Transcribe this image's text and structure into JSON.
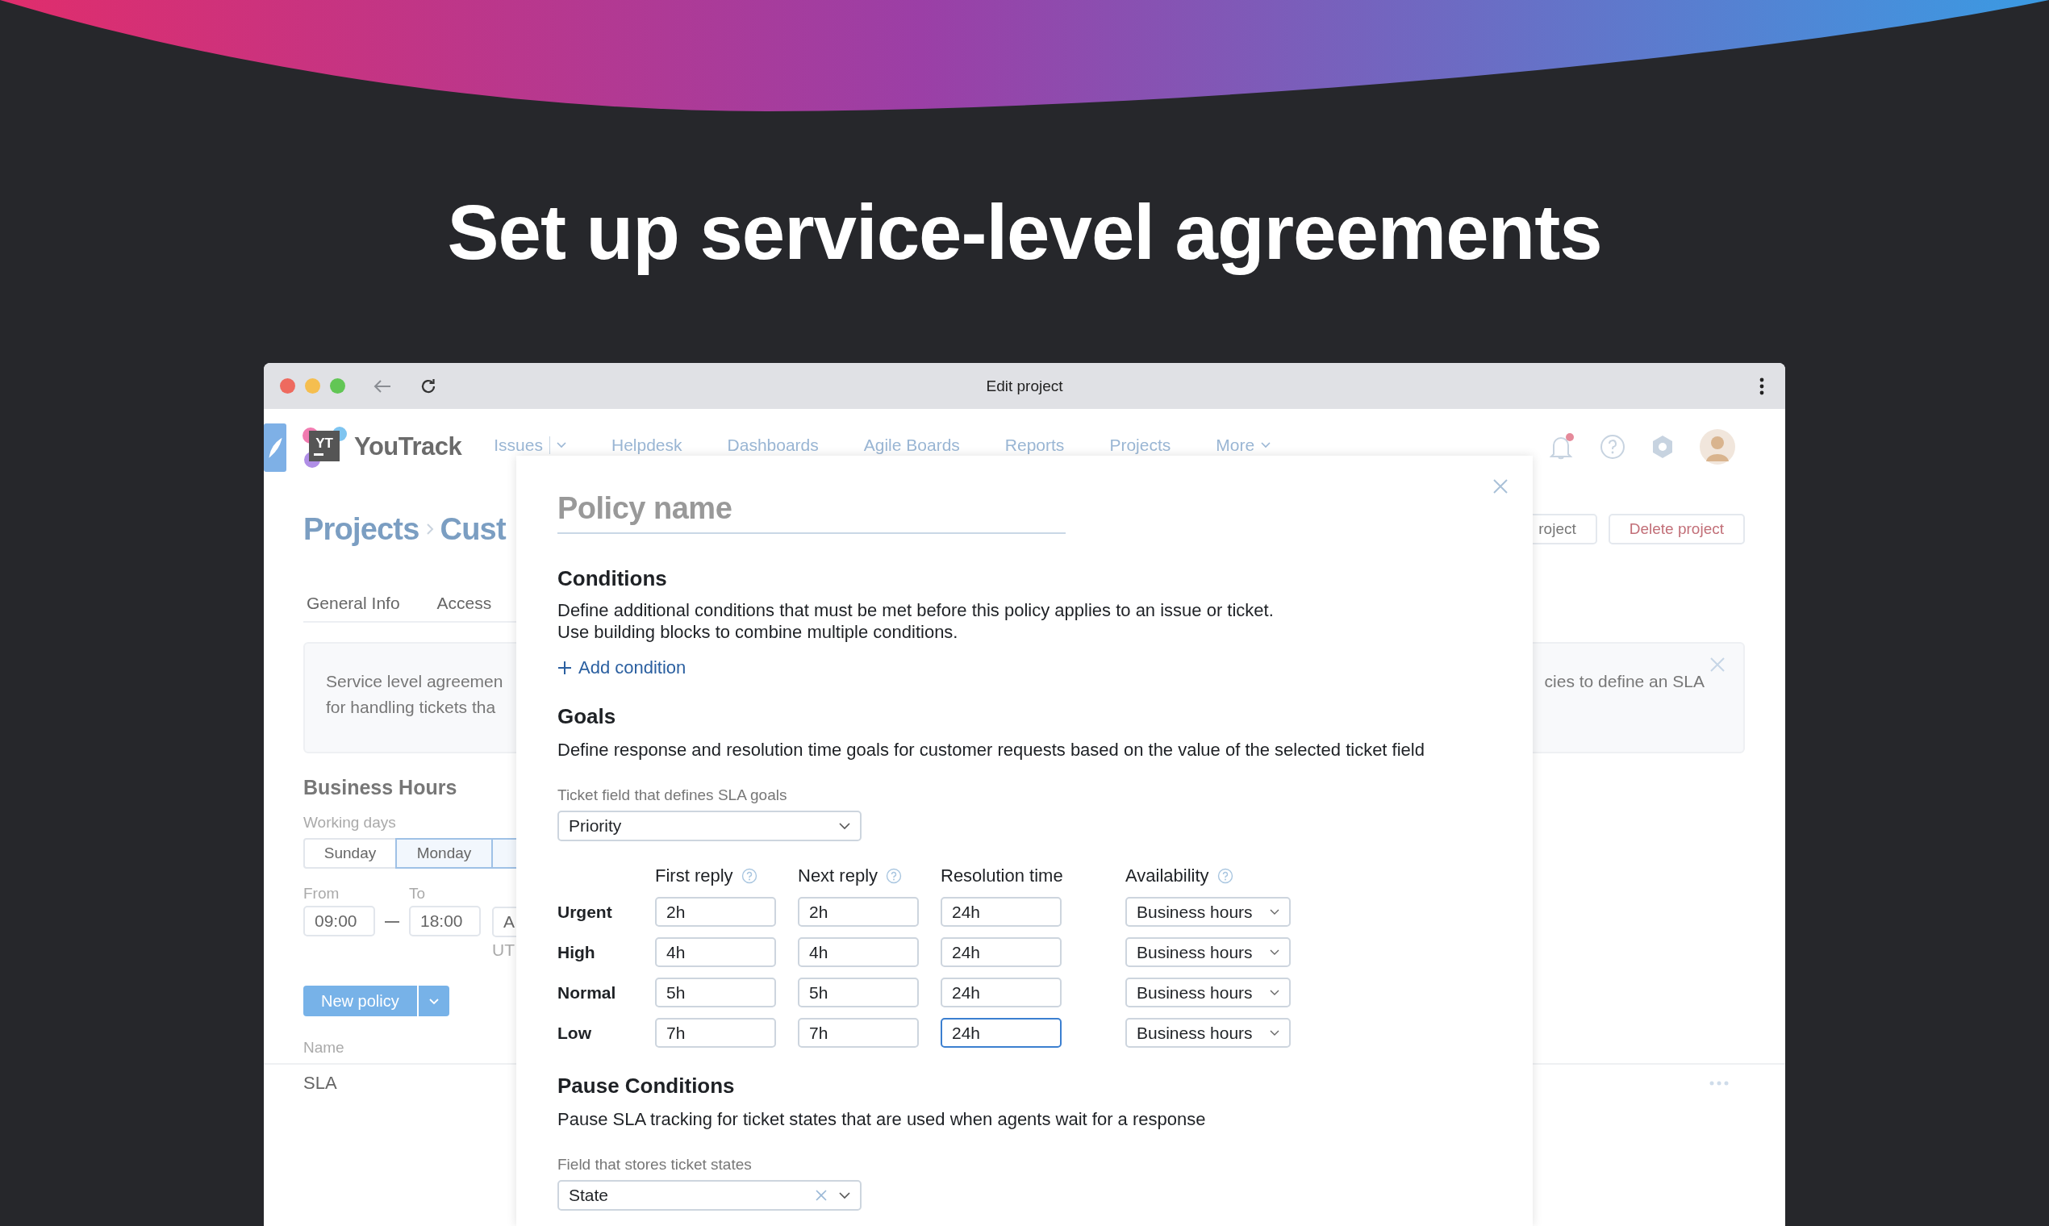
{
  "banner": {
    "headline": "Set up service-level agreements"
  },
  "window": {
    "title": "Edit project"
  },
  "nav": {
    "logo_text": "YT",
    "brand": "YouTrack",
    "notification_unread": true,
    "items": [
      {
        "label": "Issues",
        "kind": "split"
      },
      {
        "label": "Helpdesk",
        "kind": "link"
      },
      {
        "label": "Dashboards",
        "kind": "link"
      },
      {
        "label": "Agile Boards",
        "kind": "link"
      },
      {
        "label": "Reports",
        "kind": "link"
      },
      {
        "label": "Projects",
        "kind": "link"
      },
      {
        "label": "More",
        "kind": "menu"
      }
    ]
  },
  "page": {
    "breadcrumb": [
      "Projects",
      "Cust"
    ],
    "buttons": [
      {
        "label": "roject",
        "kind": "secondary"
      },
      {
        "label": "Delete project",
        "kind": "danger"
      }
    ],
    "tabs": [
      "General Info",
      "Access"
    ],
    "notice": {
      "lines": [
        "Service level agreemen",
        "for handling tickets tha"
      ],
      "right_text": "cies to define an SLA"
    },
    "business_hours": {
      "title": "Business Hours",
      "days_label": "Working days",
      "days": [
        {
          "label": "Sunday",
          "selected": false
        },
        {
          "label": "Monday",
          "selected": true
        }
      ],
      "from_label": "From",
      "to_label": "To",
      "from": "09:00",
      "to": "18:00",
      "timezone": "A",
      "timezone_note": "UT"
    },
    "new_policy": "New policy",
    "policies": {
      "column": "Name",
      "rows": [
        "SLA"
      ]
    }
  },
  "modal": {
    "policy_name_placeholder": "Policy name",
    "conditions": {
      "title": "Conditions",
      "description": [
        "Define additional conditions that must be met before this policy applies to an issue or ticket.",
        "Use building blocks to combine multiple conditions."
      ],
      "add_link": "Add condition"
    },
    "goals": {
      "title": "Goals",
      "description": "Define response and resolution time goals for customer requests based on the value of the selected ticket field",
      "field_label": "Ticket field that defines SLA goals",
      "field_value": "Priority",
      "columns": [
        "First reply",
        "Next reply",
        "Resolution time",
        "Availability"
      ],
      "rows": [
        {
          "priority": "Urgent",
          "first_reply": "2h",
          "next_reply": "2h",
          "resolution_time": "24h",
          "availability": "Business hours",
          "focused": false
        },
        {
          "priority": "High",
          "first_reply": "4h",
          "next_reply": "4h",
          "resolution_time": "24h",
          "availability": "Business hours",
          "focused": false
        },
        {
          "priority": "Normal",
          "first_reply": "5h",
          "next_reply": "5h",
          "resolution_time": "24h",
          "availability": "Business hours",
          "focused": false
        },
        {
          "priority": "Low",
          "first_reply": "7h",
          "next_reply": "7h",
          "resolution_time": "24h",
          "availability": "Business hours",
          "focused": true
        }
      ]
    },
    "pause": {
      "title": "Pause Conditions",
      "description": "Pause SLA tracking for ticket states that are used when agents wait for a response",
      "field_label": "Field that stores ticket states",
      "field_value": "State",
      "clearable": true
    }
  }
}
